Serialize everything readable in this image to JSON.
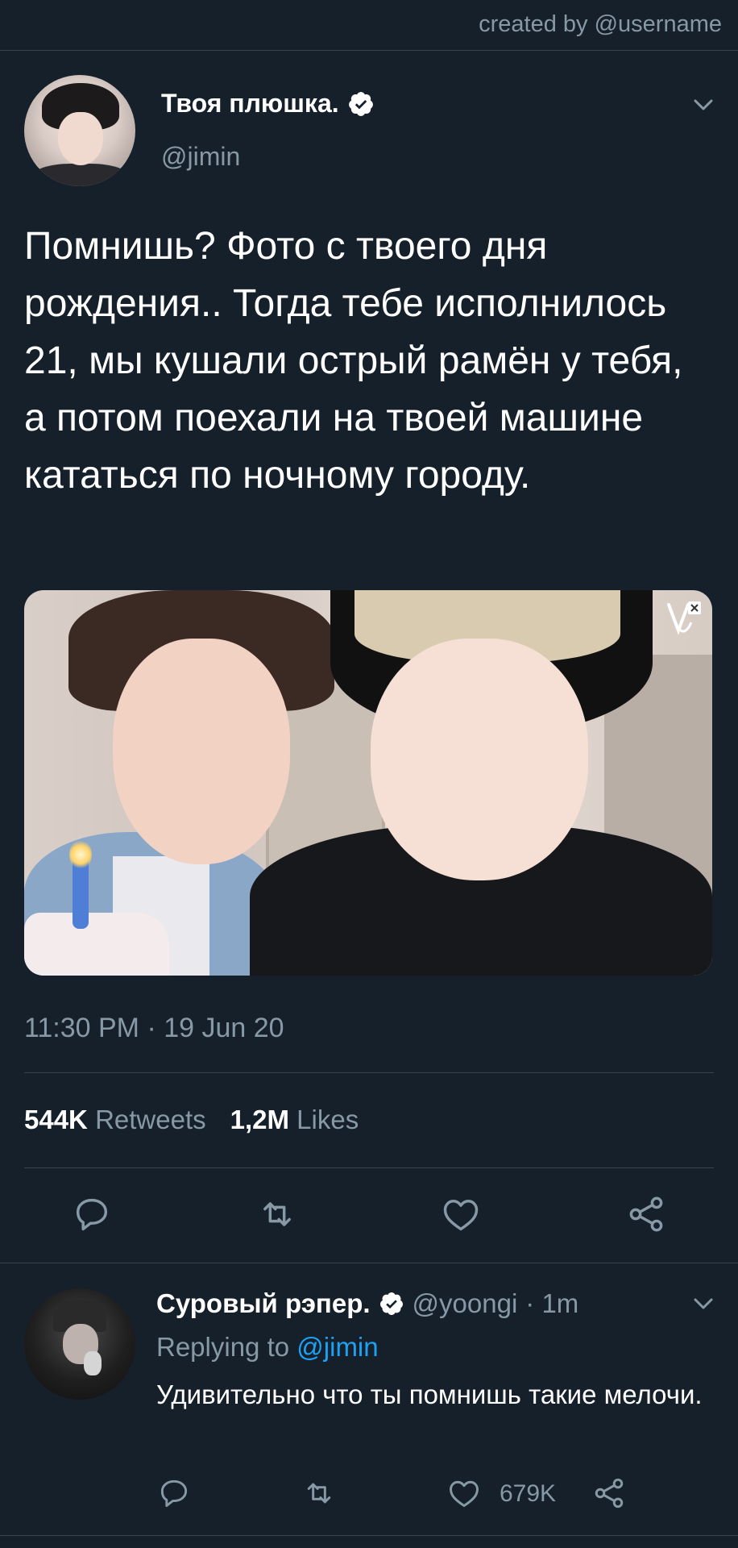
{
  "header": {
    "created_by": "created by @username"
  },
  "tweet": {
    "author_name": "Твоя плюшка.",
    "author_handle": "@jimin",
    "text": "Помнишь? Фото с твоего дня рождения.. Тогда тебе исполнилось 21, мы кушали острый рамён у тебя, а потом поехали на твоей машине кататься по ночному городу.",
    "timestamp": "11:30 PM · 19 Jun 20",
    "retweets_count": "544K",
    "retweets_label": "Retweets",
    "likes_count": "1,2M",
    "likes_label": "Likes"
  },
  "reply": {
    "author_name": "Суровый рэпер.",
    "author_handle": "@yoongi",
    "time": "· 1m",
    "replying_prefix": "Replying to",
    "replying_handle": "@jimin",
    "text": "Удивительно что ты помнишь такие мелочи.",
    "like_count": "679K"
  },
  "icons": {
    "verified": "verified-badge-icon",
    "chevron": "chevron-down-icon",
    "reply": "reply-icon",
    "retweet": "retweet-icon",
    "like": "heart-icon",
    "share": "share-icon",
    "media_logo": "vlive-logo-icon"
  },
  "colors": {
    "background": "#15202b",
    "secondary_text": "#8899a6",
    "divider": "#38444d",
    "link": "#1da1f2"
  }
}
